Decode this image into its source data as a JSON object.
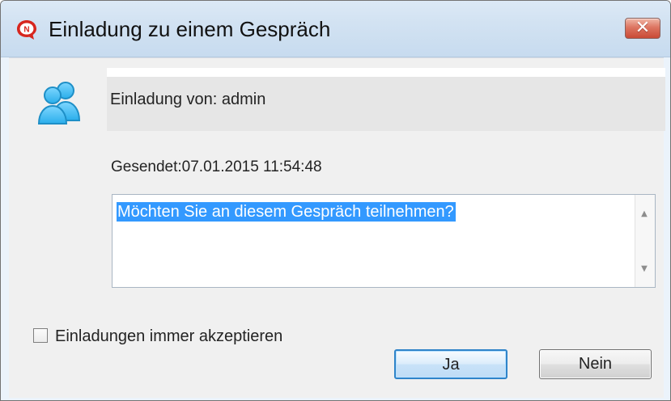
{
  "window": {
    "title": "Einladung zu einem Gespräch",
    "app_icon": "chat-bubble-n-icon",
    "close_icon": "close-icon",
    "close_glyph": "✕"
  },
  "invitation": {
    "icon": "user-group-icon",
    "from_label": "Einladung von: admin",
    "sent_label": "Gesendet:07.01.2015 11:54:48"
  },
  "message": {
    "text": "Möchten Sie an diesem Gespräch teilnehmen?",
    "scroll_up_glyph": "▲",
    "scroll_down_glyph": "▼"
  },
  "options": {
    "auto_accept_label": "Einladungen immer akzeptieren",
    "auto_accept_checked": false
  },
  "buttons": {
    "yes_label": "Ja",
    "no_label": "Nein"
  },
  "colors": {
    "title_background": "#d2e2f2",
    "dialog_background": "#f0f0f0",
    "selection": "#3399ff",
    "close_button": "#d8654f",
    "default_button_border": "#2f84c9",
    "brand_red": "#d7261e"
  }
}
